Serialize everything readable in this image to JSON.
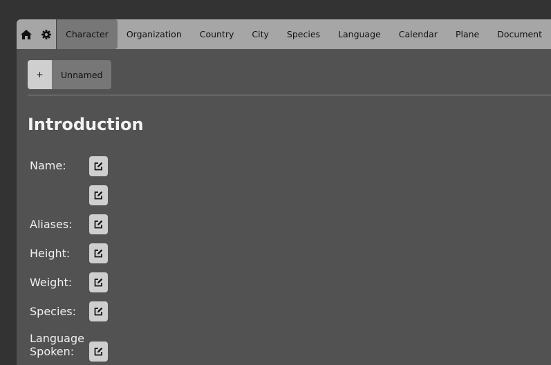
{
  "nav": {
    "home_icon": "home-icon",
    "settings_icon": "gear-icon",
    "tabs": [
      {
        "label": "Character",
        "active": true
      },
      {
        "label": "Organization"
      },
      {
        "label": "Country"
      },
      {
        "label": "City"
      },
      {
        "label": "Species"
      },
      {
        "label": "Language"
      },
      {
        "label": "Calendar"
      },
      {
        "label": "Plane"
      },
      {
        "label": "Document"
      }
    ]
  },
  "subtabs": {
    "add_label": "+",
    "entities": [
      {
        "label": "Unnamed",
        "active": true
      }
    ]
  },
  "section": {
    "title": "Introduction",
    "fields": [
      {
        "label": "Name:",
        "edit_icon": "edit-icon"
      },
      {
        "label": "",
        "edit_icon": "edit-icon"
      },
      {
        "label": "Aliases:",
        "edit_icon": "edit-icon"
      },
      {
        "label": "Height:",
        "edit_icon": "edit-icon"
      },
      {
        "label": "Weight:",
        "edit_icon": "edit-icon"
      },
      {
        "label": "Species:",
        "edit_icon": "edit-icon"
      },
      {
        "label": "Language Spoken:",
        "edit_icon": "edit-icon"
      }
    ]
  },
  "colors": {
    "page_bg": "#333333",
    "panel_bg": "#525252",
    "nav_bg": "#a6a6a6",
    "active_tab": "#777777",
    "button_bg": "#cfcfcf"
  }
}
